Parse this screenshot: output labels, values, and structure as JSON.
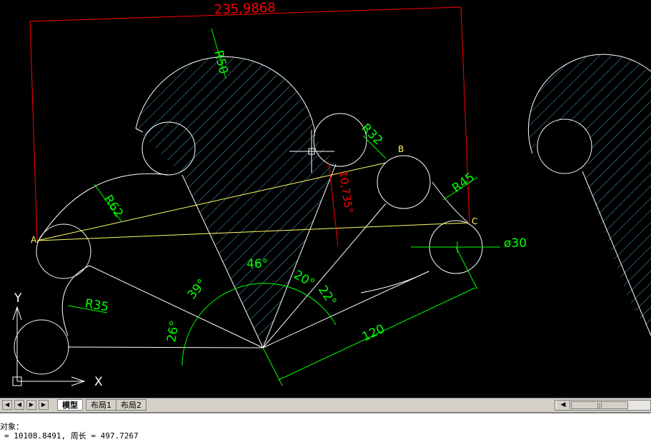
{
  "drawing": {
    "dim_overall": "235,9868",
    "dim_angle_red": "10,735°",
    "dim_r50": "R50",
    "dim_r32": "R32",
    "dim_r45": "R45",
    "dim_r62": "R62",
    "dim_r35": "R35",
    "dim_dia30": "ø30",
    "dim_120": "120",
    "ang_46": "46°",
    "ang_39": "39°",
    "ang_26": "26°",
    "ang_20": "20°",
    "ang_22": "22°",
    "point_a": "A",
    "point_b": "B",
    "point_c": "C",
    "ucs_x": "X",
    "ucs_y": "Y"
  },
  "tabs": {
    "model": "模型",
    "layout1": "布局1",
    "layout2": "布局2"
  },
  "command": {
    "line1": "对象：",
    "line2": "= 10108.8491,  周长 = 497.7267"
  },
  "colors": {
    "geometry": "#ffffff",
    "dimension": "#00ff00",
    "hatch": "#5fd7ff",
    "red_dim": "#ff0000",
    "construction": "#ffff66"
  }
}
